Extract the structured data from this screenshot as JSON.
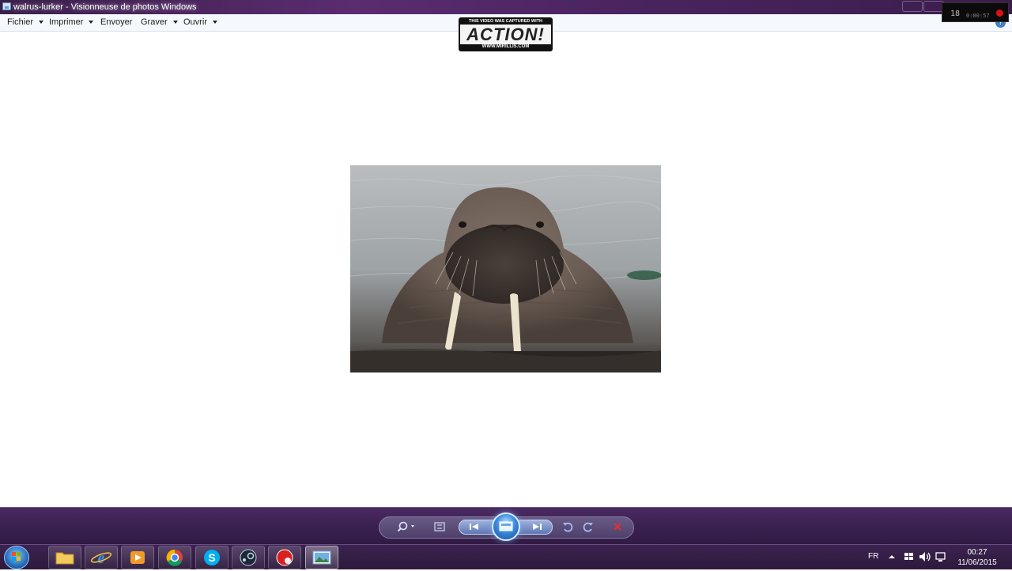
{
  "window": {
    "title": "walrus-lurker - Visionneuse de photos Windows"
  },
  "menu": {
    "items": [
      {
        "label": "Fichier",
        "has_dropdown": true
      },
      {
        "label": "Imprimer",
        "has_dropdown": true
      },
      {
        "label": "Envoyer",
        "has_dropdown": false
      },
      {
        "label": "Graver",
        "has_dropdown": true
      },
      {
        "label": "Ouvrir",
        "has_dropdown": true
      }
    ]
  },
  "watermark": {
    "top_text": "THIS VIDEO WAS CAPTURED WITH",
    "logo_text": "ACTION!",
    "bottom_text": "WWW.MIRILLIS.COM"
  },
  "recording_overlay": {
    "fps": "18",
    "elapsed": "0:00:57"
  },
  "photo": {
    "subject": "walrus"
  },
  "viewer_controls": {
    "buttons": [
      "zoom-icon",
      "actual-size-icon",
      "previous-icon",
      "slideshow-icon",
      "next-icon",
      "rotate-left-icon",
      "rotate-right-icon",
      "delete-icon"
    ]
  },
  "taskbar": {
    "apps": [
      "start-orb-icon",
      "file-explorer-icon",
      "internet-explorer-icon",
      "media-player-icon",
      "chrome-icon",
      "skype-icon",
      "steam-icon",
      "recorder-icon",
      "photo-viewer-icon"
    ],
    "language": "FR",
    "time": "00:27",
    "date": "11/06/2015"
  },
  "colors": {
    "taskbar": "#2c1a3c",
    "titlebar": "#4a2560",
    "menubar": "#f5f9fd",
    "delete_red": "#e03030"
  }
}
